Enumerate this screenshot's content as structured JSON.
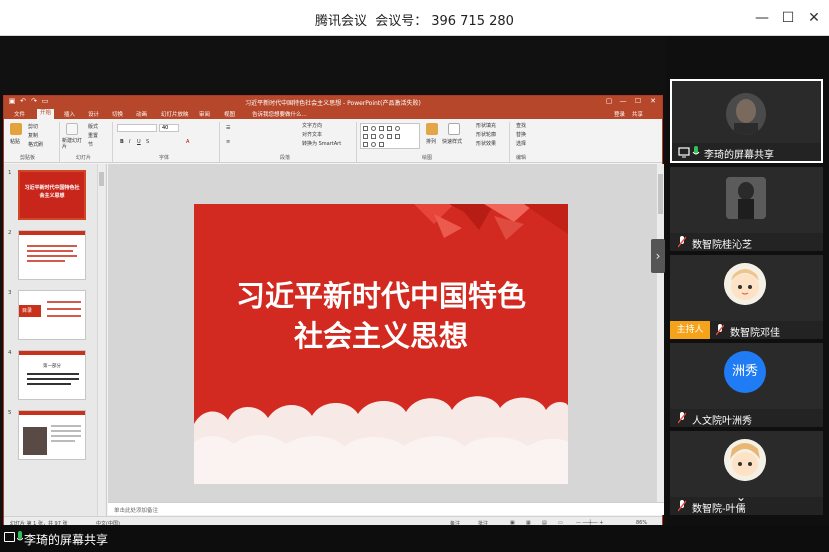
{
  "meeting": {
    "app_name": "腾讯会议",
    "id_label": "会议号：",
    "meeting_id": "396 715 280",
    "window_controls": {
      "minimize": "—",
      "maximize": "☐",
      "close": "✕"
    }
  },
  "ppt": {
    "title": "习近平新时代中国特色社会主义思想 - PowerPoint(产品激活失败)",
    "window_controls": {
      "help": "?",
      "minimize": "—",
      "maximize": "☐",
      "close": "✕"
    },
    "tabs": [
      "文件",
      "开始",
      "插入",
      "设计",
      "切换",
      "动画",
      "幻灯片放映",
      "审阅",
      "视图"
    ],
    "active_tab": "开始",
    "tell_me": "告诉我您想要做什么...",
    "login": "登录",
    "share": "共享",
    "ribbon": {
      "paste": "粘贴",
      "cut": "剪切",
      "copy": "复制",
      "format_painter": "格式刷",
      "new_slide": "新建幻灯片",
      "layout": "版式",
      "reset": "重置",
      "section": "节",
      "font_size": "40",
      "text_direction": "文字方向",
      "align_text": "对齐文本",
      "smartart": "转换为 SmartArt",
      "arrange": "排列",
      "quick_styles": "快速样式",
      "shape_fill": "形状填充",
      "shape_outline": "形状轮廓",
      "shape_effects": "形状效果",
      "find": "查找",
      "replace": "替换",
      "select": "选择",
      "groups": [
        "剪贴板",
        "幻灯片",
        "字体",
        "段落",
        "绘图",
        "编辑"
      ]
    },
    "slide_numbers": [
      "1",
      "2",
      "3",
      "4",
      "5"
    ],
    "thumb1_text": "习近平新时代中国特色社会主义思想",
    "thumb3_label": "目录",
    "thumb4_label": "第一部分",
    "slide_title_line1": "习近平新时代中国特色",
    "slide_title_line2": "社会主义思想",
    "notes_placeholder": "单击此处添加备注",
    "status": {
      "slide_count": "幻灯片 第 1 张，共 97 张",
      "language": "中文(中国)",
      "notes": "备注",
      "comments": "批注",
      "zoom": "86%"
    }
  },
  "participants": [
    {
      "name": "李琦的屏幕共享",
      "avatar_type": "photo",
      "sharing": true,
      "mic_color": "#2ec15c"
    },
    {
      "name": "数智院桂沁芝",
      "avatar_type": "photo",
      "sharing": false,
      "mic_color": "#e84a3d"
    },
    {
      "name": "数智院邓佳",
      "avatar_type": "cartoon",
      "host": true,
      "host_label": "主持人",
      "mic_color": "#e84a3d"
    },
    {
      "name": "人文院叶洲秀",
      "avatar_type": "text",
      "avatar_text": "洲秀",
      "mic_color": "#e84a3d"
    },
    {
      "name": "数智院-叶儒",
      "avatar_type": "cartoon",
      "mic_color": "#e84a3d"
    }
  ],
  "bottom": {
    "sharing_label": "李琦的屏幕共享"
  },
  "colors": {
    "ppt_accent": "#b7472a",
    "slide_red": "#d22a20",
    "host_badge": "#f5a31a",
    "text_avatar": "#1f7cf5"
  }
}
